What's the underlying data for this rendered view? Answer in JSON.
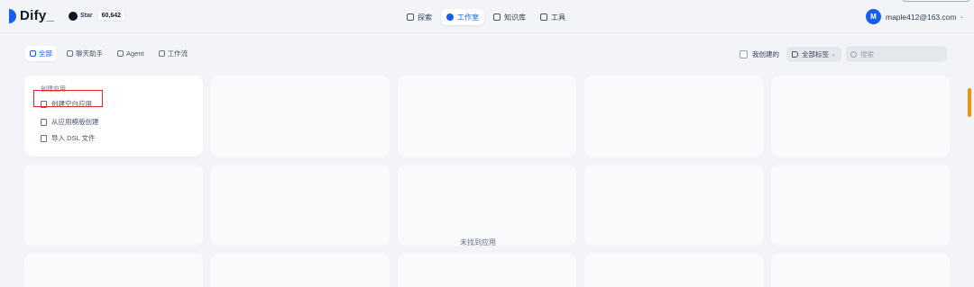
{
  "header": {
    "logo_text": "Dify",
    "logo_suffix": "_",
    "github_label": "Star",
    "github_count": "60,642",
    "nav": [
      {
        "label": "探索",
        "icon": "compass-icon",
        "active": false
      },
      {
        "label": "工作室",
        "icon": "robot-icon",
        "active": true
      },
      {
        "label": "知识库",
        "icon": "book-icon",
        "active": false
      },
      {
        "label": "工具",
        "icon": "hammer-icon",
        "active": false
      }
    ],
    "avatar_letter": "M",
    "user_email": "maple412@163.com",
    "caret": "⌄"
  },
  "filters": {
    "tabs": [
      {
        "label": "全部",
        "icon": "grid-icon",
        "active": true
      },
      {
        "label": "聊天助手",
        "icon": "chat-icon",
        "active": false
      },
      {
        "label": "Agent",
        "icon": "agent-icon",
        "active": false
      },
      {
        "label": "工作流",
        "icon": "workflow-icon",
        "active": false
      }
    ],
    "my_created": "我创建的",
    "tags_label": "全部标签",
    "search_placeholder": "搜索"
  },
  "create_card": {
    "title": "创建应用",
    "items": [
      "创建空白应用",
      "从应用模版创建",
      "导入 DSL 文件"
    ]
  },
  "empty_text": "未找到应用",
  "colors": {
    "accent": "#155eef",
    "highlight": "#d92d20",
    "background": "#f2f4f7"
  }
}
